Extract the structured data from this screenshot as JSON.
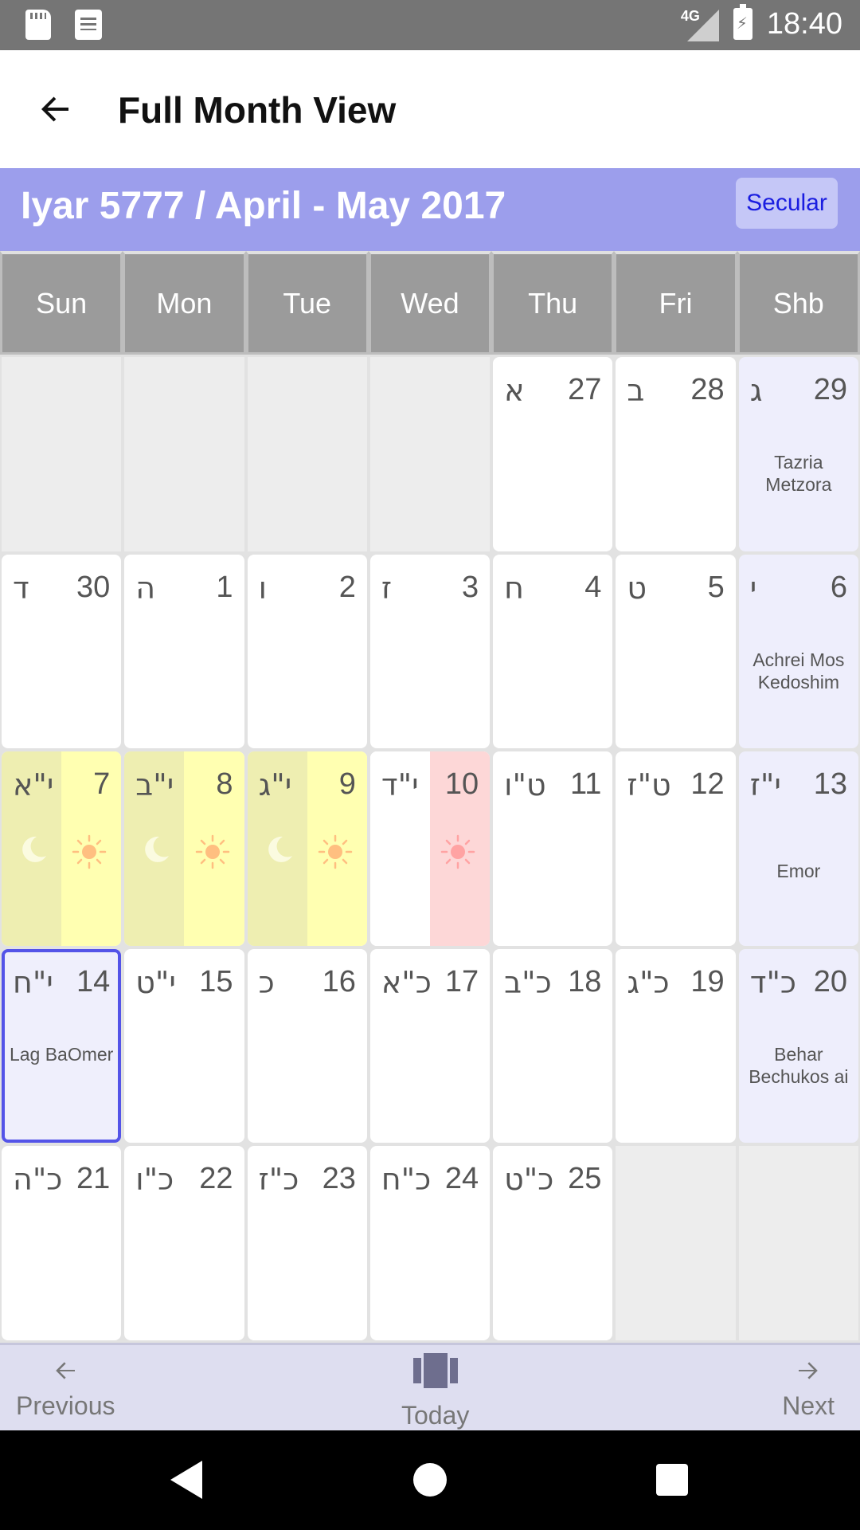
{
  "status_bar": {
    "time": "18:40",
    "network": "4G"
  },
  "app_bar": {
    "title": "Full Month View"
  },
  "month_header": {
    "title": "Iyar 5777 / April - May 2017",
    "secular_label": "Secular"
  },
  "weekdays": [
    "Sun",
    "Mon",
    "Tue",
    "Wed",
    "Thu",
    "Fri",
    "Shb"
  ],
  "week1": {
    "thu": {
      "day": "27",
      "heb": "א"
    },
    "fri": {
      "day": "28",
      "heb": "ב"
    },
    "shb": {
      "day": "29",
      "heb": "ג",
      "parsha": "Tazria Metzora"
    }
  },
  "week2": {
    "sun": {
      "day": "30",
      "heb": "ד"
    },
    "mon": {
      "day": "1",
      "heb": "ה"
    },
    "tue": {
      "day": "2",
      "heb": "ו"
    },
    "wed": {
      "day": "3",
      "heb": "ז"
    },
    "thu": {
      "day": "4",
      "heb": "ח"
    },
    "fri": {
      "day": "5",
      "heb": "ט"
    },
    "shb": {
      "day": "6",
      "heb": "י",
      "parsha": "Achrei Mos Kedoshim"
    }
  },
  "week3": {
    "sun": {
      "day": "7",
      "heb": "י\"א"
    },
    "mon": {
      "day": "8",
      "heb": "י\"ב"
    },
    "tue": {
      "day": "9",
      "heb": "י\"ג"
    },
    "wed": {
      "day": "10",
      "heb": "י\"ד"
    },
    "thu": {
      "day": "11",
      "heb": "ט\"ו"
    },
    "fri": {
      "day": "12",
      "heb": "ט\"ז"
    },
    "shb": {
      "day": "13",
      "heb": "י\"ז",
      "parsha": "Emor"
    }
  },
  "week4": {
    "sun": {
      "day": "14",
      "heb": "י\"ח",
      "parsha": "Lag BaOmer"
    },
    "mon": {
      "day": "15",
      "heb": "י\"ט"
    },
    "tue": {
      "day": "16",
      "heb": "כ"
    },
    "wed": {
      "day": "17",
      "heb": "כ\"א"
    },
    "thu": {
      "day": "18",
      "heb": "כ\"ב"
    },
    "fri": {
      "day": "19",
      "heb": "כ\"ג"
    },
    "shb": {
      "day": "20",
      "heb": "כ\"ד",
      "parsha": "Behar Bechukos ai"
    }
  },
  "week5": {
    "sun": {
      "day": "21",
      "heb": "כ\"ה"
    },
    "mon": {
      "day": "22",
      "heb": "כ\"ו"
    },
    "tue": {
      "day": "23",
      "heb": "כ\"ז"
    },
    "wed": {
      "day": "24",
      "heb": "כ\"ח"
    },
    "thu": {
      "day": "25",
      "heb": "כ\"ט"
    }
  },
  "bottom_nav": {
    "previous": "Previous",
    "today": "Today",
    "next": "Next"
  },
  "colors": {
    "accent": "#9c9eec",
    "secular_text": "#1a1de0",
    "moon_cell": "#eeeeb1",
    "sun_cell": "#ffffb1",
    "fast_cell": "#fdd7d7",
    "today_outline": "#5454e8"
  }
}
